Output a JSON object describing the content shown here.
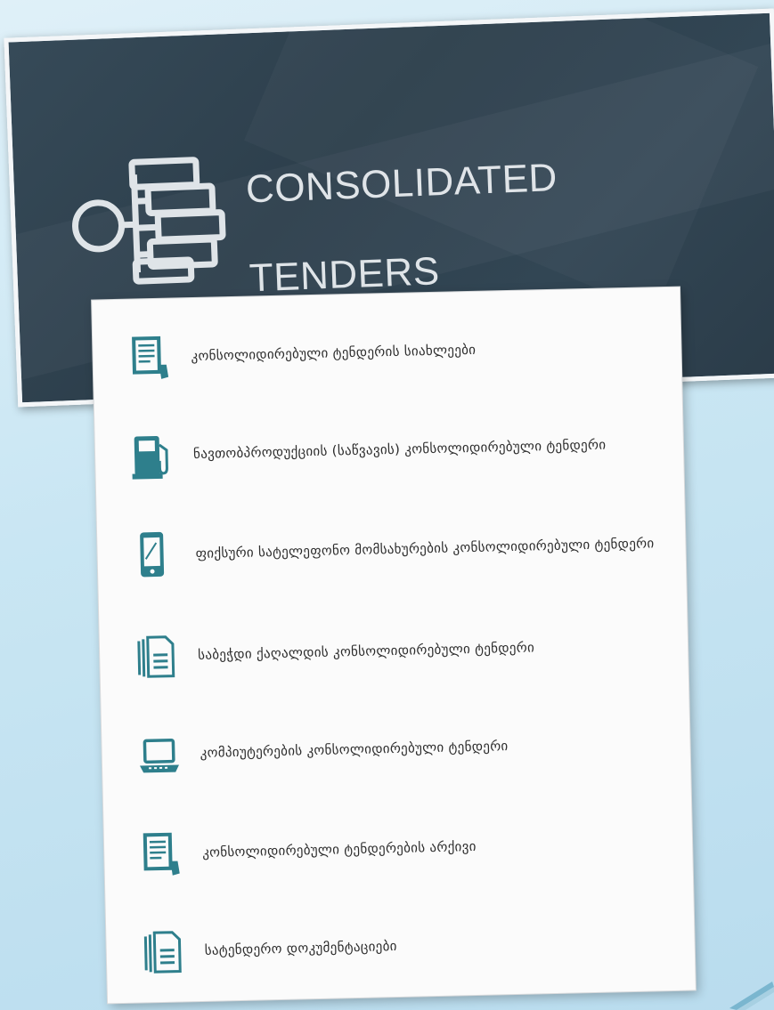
{
  "banner": {
    "title_line1": "CONSOLIDATED",
    "title_line2": "TENDERS",
    "logo_icon": "hierarchy-icon"
  },
  "colors": {
    "banner_bg": "#2f4250",
    "accent_teal": "#2e7f8c",
    "text": "#2c2c2c"
  },
  "menu": {
    "items": [
      {
        "icon": "document-edit-icon",
        "label": "კონსოლიდირებული ტენდერის სიახლეები"
      },
      {
        "icon": "fuel-pump-icon",
        "label": "ნავთობპროდუქციის (საწვავის) კონსოლიდირებული ტენდერი"
      },
      {
        "icon": "mobile-phone-icon",
        "label": "ფიქსური სატელეფონო მომსახურების კონსოლიდირებული ტენდერი"
      },
      {
        "icon": "stacked-documents-icon",
        "label": "საბეჭდი ქაღალდის კონსოლიდირებული ტენდერი"
      },
      {
        "icon": "laptop-icon",
        "label": "კომპიუტერების კონსოლიდირებული ტენდერი"
      },
      {
        "icon": "document-edit-icon",
        "label": "კონსოლიდირებული ტენდერების არქივი"
      },
      {
        "icon": "stacked-documents-icon",
        "label": "სატენდერო დოკუმენტაციები"
      }
    ]
  }
}
